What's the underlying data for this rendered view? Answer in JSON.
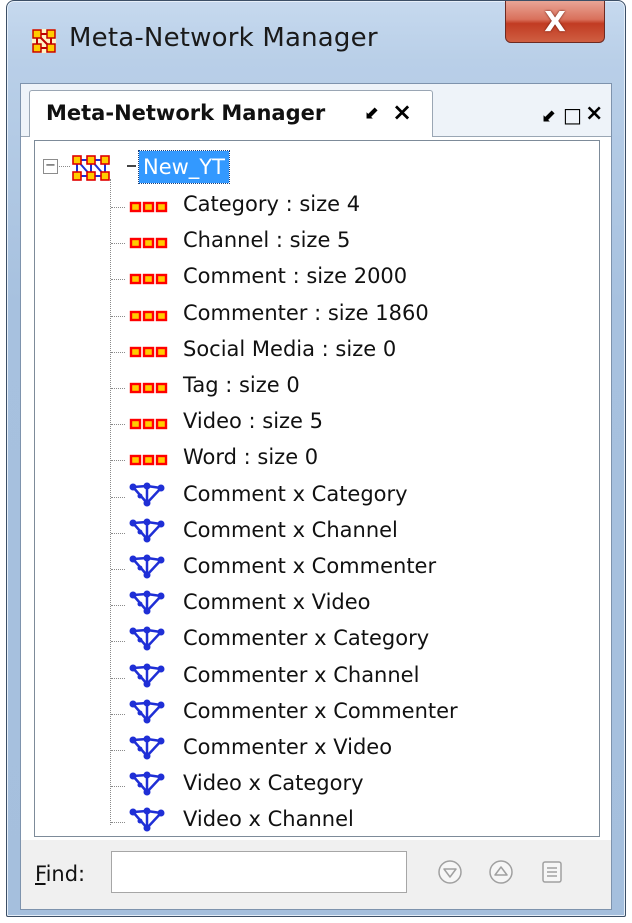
{
  "window": {
    "title": "Meta-Network Manager",
    "close_glyph": "X"
  },
  "panel": {
    "tab_label": "Meta-Network Manager",
    "tab_pin_glyph": "⬋",
    "tab_close_glyph": "×",
    "ctrl_pin_glyph": "⬋",
    "ctrl_max_glyph": "□",
    "ctrl_close_glyph": "×"
  },
  "tree": {
    "expander_glyph": "−",
    "root_label": "New_YT",
    "node_sets": [
      {
        "label": "Category : size 4",
        "icon": "node-set-icon"
      },
      {
        "label": "Channel : size 5",
        "icon": "node-set-icon"
      },
      {
        "label": "Comment : size 2000",
        "icon": "node-set-icon"
      },
      {
        "label": "Commenter : size 1860",
        "icon": "node-set-icon"
      },
      {
        "label": "Social Media : size 0",
        "icon": "node-set-icon"
      },
      {
        "label": "Tag : size 0",
        "icon": "node-set-icon"
      },
      {
        "label": "Video : size 5",
        "icon": "node-set-icon"
      },
      {
        "label": "Word : size 0",
        "icon": "node-set-icon"
      }
    ],
    "networks": [
      {
        "label": "Comment x Category",
        "icon": "network-icon"
      },
      {
        "label": "Comment x Channel",
        "icon": "network-icon"
      },
      {
        "label": "Comment x Commenter",
        "icon": "network-icon"
      },
      {
        "label": "Comment x Video",
        "icon": "network-icon"
      },
      {
        "label": "Commenter x Category",
        "icon": "network-icon"
      },
      {
        "label": "Commenter x Channel",
        "icon": "network-icon"
      },
      {
        "label": "Commenter x Commenter",
        "icon": "network-icon"
      },
      {
        "label": "Commenter x Video",
        "icon": "network-icon"
      },
      {
        "label": "Video x Category",
        "icon": "network-icon"
      },
      {
        "label": "Video x Channel",
        "icon": "network-icon"
      }
    ]
  },
  "find": {
    "label_accel": "F",
    "label_rest": "ind:",
    "value": "",
    "placeholder": ""
  },
  "colors": {
    "selection": "#3399ff",
    "node_icon": "#ff0000",
    "node_icon_fill": "#ffcc00",
    "network_icon": "#1f2fd6"
  }
}
